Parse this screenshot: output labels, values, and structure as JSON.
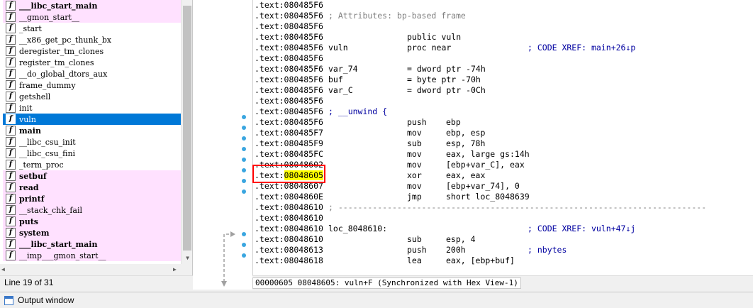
{
  "functions": {
    "items": [
      {
        "name": "___libc_start_main",
        "style": "import bold"
      },
      {
        "name": "__gmon_start__",
        "style": "import"
      },
      {
        "name": "_start",
        "style": ""
      },
      {
        "name": "__x86_get_pc_thunk_bx",
        "style": ""
      },
      {
        "name": "deregister_tm_clones",
        "style": ""
      },
      {
        "name": "register_tm_clones",
        "style": ""
      },
      {
        "name": "__do_global_dtors_aux",
        "style": ""
      },
      {
        "name": "frame_dummy",
        "style": ""
      },
      {
        "name": "getshell",
        "style": ""
      },
      {
        "name": "init",
        "style": ""
      },
      {
        "name": "vuln",
        "style": "selected"
      },
      {
        "name": "main",
        "style": "bold"
      },
      {
        "name": "__libc_csu_init",
        "style": ""
      },
      {
        "name": "__libc_csu_fini",
        "style": ""
      },
      {
        "name": "_term_proc",
        "style": ""
      },
      {
        "name": "setbuf",
        "style": "import bold"
      },
      {
        "name": "read",
        "style": "import bold"
      },
      {
        "name": "printf",
        "style": "import bold"
      },
      {
        "name": "__stack_chk_fail",
        "style": "import"
      },
      {
        "name": "puts",
        "style": "import bold"
      },
      {
        "name": "system",
        "style": "import bold"
      },
      {
        "name": "___libc_start_main",
        "style": "import bold"
      },
      {
        "name": "__imp___gmon_start__",
        "style": "import"
      }
    ],
    "icon_glyph": "f",
    "line_status": "Line 19 of 31"
  },
  "disasm": [
    {
      "addr": ".text:080485F6"
    },
    {
      "addr": ".text:080485F6",
      "lbl": "; Attributes: bp-based frame",
      "lbl_cls": "grey"
    },
    {
      "addr": ".text:080485F6"
    },
    {
      "addr": ".text:080485F6",
      "mn": "public vuln"
    },
    {
      "addr": ".text:080485F6",
      "lbl": "vuln",
      "mn": "proc near",
      "cm": "; CODE XREF: main+26↓p"
    },
    {
      "addr": ".text:080485F6"
    },
    {
      "addr": ".text:080485F6",
      "lbl": "var_74",
      "mn": "= dword ptr -74h"
    },
    {
      "addr": ".text:080485F6",
      "lbl": "buf",
      "mn": "= byte ptr -70h"
    },
    {
      "addr": ".text:080485F6",
      "lbl": "var_C",
      "mn": "= dword ptr -0Ch"
    },
    {
      "addr": ".text:080485F6"
    },
    {
      "addr": ".text:080485F6",
      "lbl": "; __unwind {",
      "lbl_cls": "blue"
    },
    {
      "addr": ".text:080485F6",
      "mn": "push",
      "op": "ebp"
    },
    {
      "addr": ".text:080485F7",
      "mn": "mov",
      "op": "ebp, esp"
    },
    {
      "addr": ".text:080485F9",
      "mn": "sub",
      "op": "esp, 78h"
    },
    {
      "addr": ".text:080485FC",
      "mn": "mov",
      "op": "eax, large gs:14h"
    },
    {
      "addr": ".text:08048602",
      "mn": "mov",
      "op": "[ebp+var_C], eax"
    },
    {
      "addr_prefix": ".text:",
      "addr_hl": "08048605",
      "mn": "xor",
      "op": "eax, eax"
    },
    {
      "addr": ".text:08048607",
      "mn": "mov",
      "op": "[ebp+var_74], 0"
    },
    {
      "addr": ".text:0804860E",
      "mn": "jmp",
      "op": "short loc_8048639"
    },
    {
      "addr": ".text:08048610",
      "sep": "; ---------------------------------------------------------------------------"
    },
    {
      "addr": ".text:08048610"
    },
    {
      "addr": ".text:08048610",
      "lbl": "loc_8048610:",
      "cm": "; CODE XREF: vuln+47↓j"
    },
    {
      "addr": ".text:08048610",
      "mn": "sub",
      "op": "esp, 4"
    },
    {
      "addr": ".text:08048613",
      "mn": "push",
      "op": "200h",
      "cm": "; nbytes"
    },
    {
      "addr": ".text:08048618",
      "mn": "lea",
      "op": "eax, [ebp+buf]"
    }
  ],
  "sync_status": "00000605 08048605: vuln+F (Synchronized with Hex View-1)",
  "output_window_label": "Output window",
  "colors": {
    "import_bg": "#ffe1ff",
    "selected_bg": "#0078d7",
    "comment": "#0000a0",
    "highlight": "#ffff00",
    "annotation_box": "#ff0000"
  }
}
